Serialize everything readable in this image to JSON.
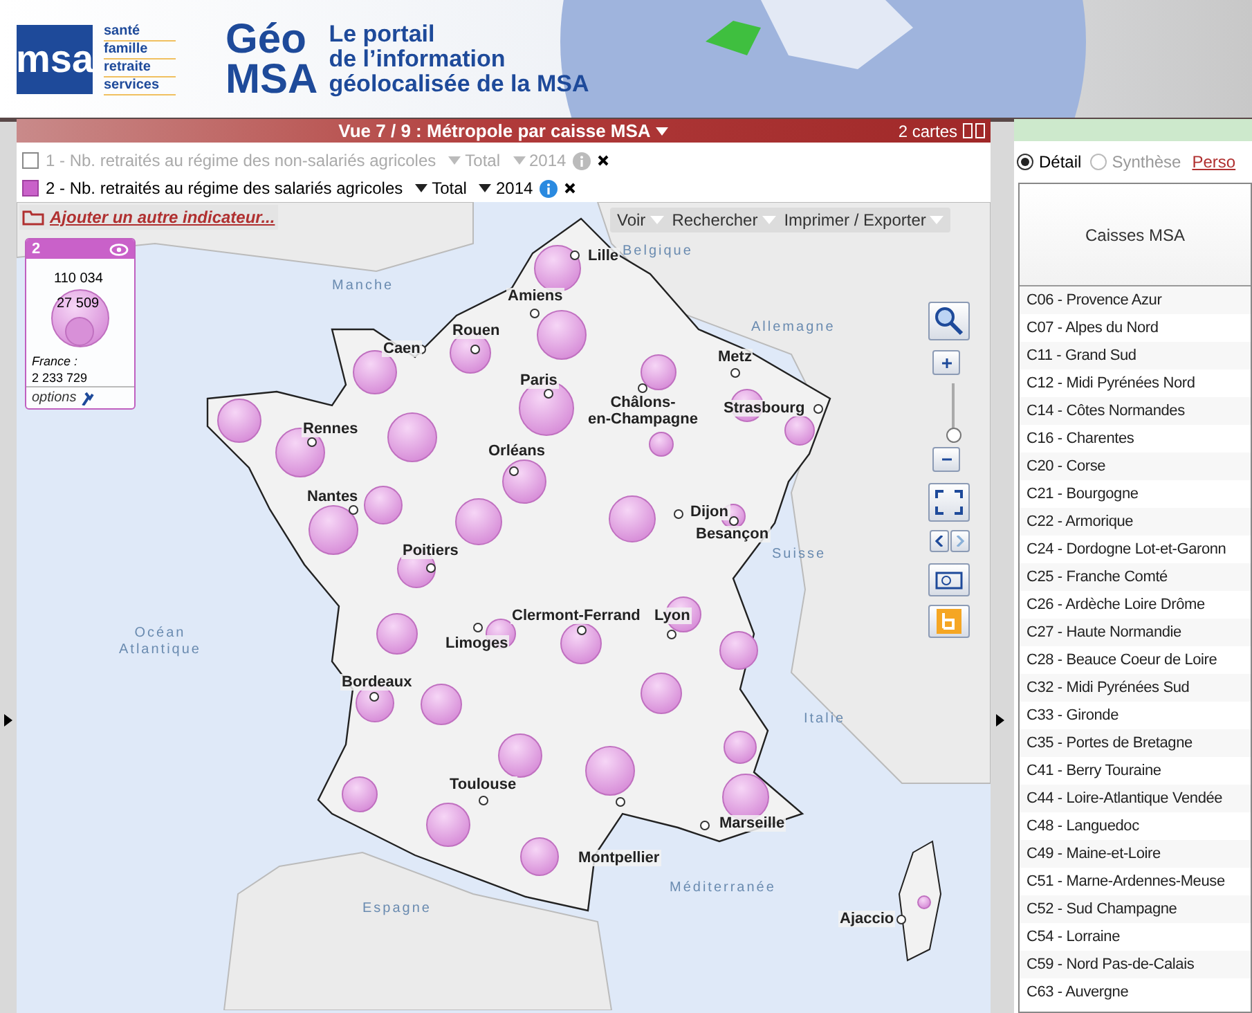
{
  "header": {
    "logo_text": "msa",
    "tagline": [
      "santé",
      "famille",
      "retraite",
      "services"
    ],
    "brand": [
      "Géo",
      "MSA"
    ],
    "title_lines": [
      "Le portail",
      "de l’information",
      "géolocalisée de la MSA"
    ]
  },
  "view_bar": {
    "title": "Vue 7 / 9 : Métropole par caisse MSA",
    "maps_count": "2 cartes"
  },
  "indicators": [
    {
      "label": "1 - Nb. retraités au régime des non-salariés agricoles",
      "checked": false,
      "measure": "Total",
      "year": "2014"
    },
    {
      "label": "2 - Nb. retraités au régime des salariés agricoles",
      "checked": true,
      "measure": "Total",
      "year": "2014"
    }
  ],
  "add_indicator": "Ajouter un autre indicateur...",
  "toolbar": [
    "Voir",
    "Rechercher",
    "Imprimer / Exporter"
  ],
  "legend": {
    "number": "2",
    "max": "110 034",
    "min": "27 509",
    "total_label": "France :",
    "total": "2 233 729",
    "options": "options"
  },
  "map": {
    "cities": [
      "Lille",
      "Amiens",
      "Rouen",
      "Caen",
      "Paris",
      "Metz",
      "Châlons-\nen-Champagne",
      "Strasbourg",
      "Rennes",
      "Orléans",
      "Nantes",
      "Dijon",
      "Besançon",
      "Poitiers",
      "Clermont-Ferrand",
      "Lyon",
      "Limoges",
      "Bordeaux",
      "Toulouse",
      "Montpellier",
      "Marseille",
      "Ajaccio"
    ],
    "zoom_slider": {
      "level": 0
    },
    "places": [
      "Manche",
      "Belgique",
      "Allemagne",
      "Suisse",
      "Italie",
      "Océan\nAtlantique",
      "Espagne",
      "Méditerranée"
    ]
  },
  "right_panel": {
    "modes": [
      {
        "label": "Détail",
        "selected": true
      },
      {
        "label": "Synthèse",
        "selected": false
      }
    ],
    "link": "Perso",
    "column": "Caisses MSA",
    "rows": [
      "C06 - Provence Azur",
      "C07 - Alpes du Nord",
      "C11 - Grand Sud",
      "C12 - Midi Pyrénées Nord",
      "C14 - Côtes Normandes",
      "C16 - Charentes",
      "C20 - Corse",
      "C21 - Bourgogne",
      "C22 - Armorique",
      "C24 - Dordogne Lot-et-Garonn",
      "C25 - Franche Comté",
      "C26 - Ardèche Loire Drôme",
      "C27 - Haute Normandie",
      "C28 - Beauce Coeur de Loire",
      "C32 - Midi Pyrénées Sud",
      "C33 - Gironde",
      "C35 - Portes de Bretagne",
      "C41 - Berry Touraine",
      "C44 - Loire-Atlantique Vendée",
      "C48 - Languedoc",
      "C49 - Maine-et-Loire",
      "C51 - Marne-Ardennes-Meuse",
      "C52 - Sud Champagne",
      "C54 - Lorraine",
      "C59 - Nord Pas-de-Calais",
      "C63 - Auvergne"
    ]
  }
}
